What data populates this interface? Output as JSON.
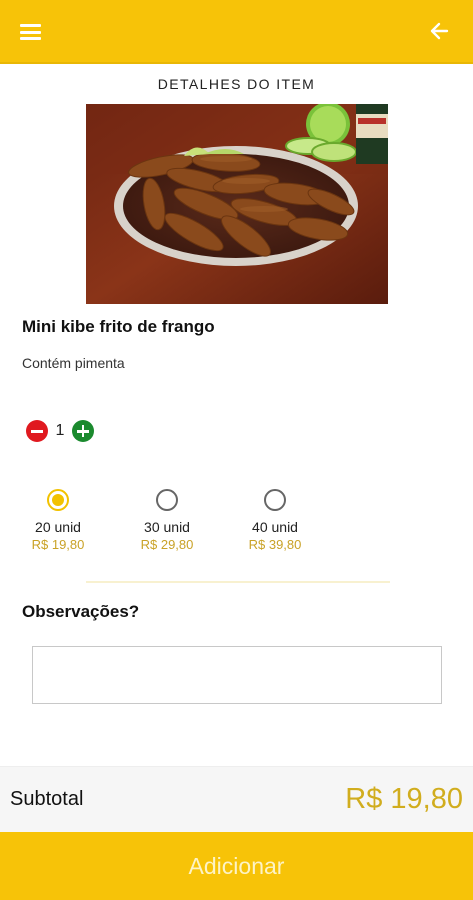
{
  "header": {
    "menu_icon": "hamburger-menu-icon",
    "back_icon": "arrow-left-icon",
    "background_color": "#f7c308"
  },
  "page": {
    "title": "DETALHES DO ITEM"
  },
  "item": {
    "image": "photo-fried-kibbeh-platter",
    "name": "Mini kibe frito de frango",
    "description": "Contém pimenta"
  },
  "quantity": {
    "value": "1",
    "minus_icon": "minus-circle-icon",
    "plus_icon": "plus-circle-icon"
  },
  "options": [
    {
      "label": "20 unid",
      "price": "R$ 19,80",
      "selected": true
    },
    {
      "label": "30 unid",
      "price": "R$ 29,80",
      "selected": false
    },
    {
      "label": "40 unid",
      "price": "R$ 39,80",
      "selected": false
    }
  ],
  "notes": {
    "title": "Observações?",
    "value": "",
    "placeholder": ""
  },
  "summary": {
    "subtotal_label": "Subtotal",
    "subtotal_value": "R$ 19,80"
  },
  "actions": {
    "add_label": "Adicionar"
  },
  "colors": {
    "accent": "#f7c308",
    "price": "#c9a227",
    "minus": "#e0191f",
    "plus": "#1b8a2e"
  }
}
